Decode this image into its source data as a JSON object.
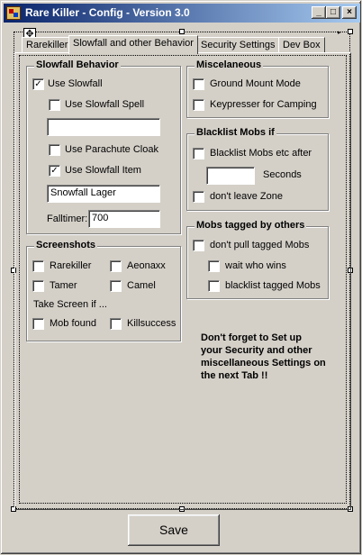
{
  "window": {
    "title": "Rare Killer - Config - Version 3.0",
    "controls": {
      "minimize": "_",
      "maximize": "□",
      "close": "×"
    }
  },
  "tabs": [
    {
      "label": "Rarekiller",
      "active": false
    },
    {
      "label": "Slowfall and other Behavior",
      "active": true
    },
    {
      "label": "Security Settings",
      "active": false
    },
    {
      "label": "Dev Box",
      "active": false
    }
  ],
  "slowfall": {
    "title": "Slowfall Behavior",
    "use_slowfall": {
      "label": "Use Slowfall",
      "checked": true
    },
    "use_slowfall_spell": {
      "label": "Use Slowfall Spell",
      "checked": false
    },
    "spell_value": "",
    "use_parachute": {
      "label": "Use Parachute Cloak",
      "checked": false
    },
    "use_item": {
      "label": "Use Slowfall Item",
      "checked": true
    },
    "item_value": "Snowfall Lager",
    "falltimer_label": "Falltimer:",
    "falltimer_value": "700"
  },
  "misc": {
    "title": "Miscelaneous",
    "ground_mount": {
      "label": "Ground Mount Mode",
      "checked": false
    },
    "keypresser": {
      "label": "Keypresser for Camping",
      "checked": false
    }
  },
  "blacklist": {
    "title": "Blacklist Mobs if",
    "after": {
      "label": "Blacklist Mobs etc after",
      "checked": false
    },
    "seconds_value": "",
    "seconds_label": "Seconds",
    "dont_leave": {
      "label": "don't leave Zone",
      "checked": false
    }
  },
  "tagged": {
    "title": "Mobs tagged by others",
    "dont_pull": {
      "label": "don't pull tagged Mobs",
      "checked": false
    },
    "wait": {
      "label": "wait who wins",
      "checked": false
    },
    "blacklist_tagged": {
      "label": "blacklist tagged Mobs",
      "checked": false
    }
  },
  "screenshots": {
    "title": "Screenshots",
    "rarekiller": {
      "label": "Rarekiller",
      "checked": false
    },
    "aeonaxx": {
      "label": "Aeonaxx",
      "checked": false
    },
    "tamer": {
      "label": "Tamer",
      "checked": false
    },
    "camel": {
      "label": "Camel",
      "checked": false
    },
    "take_screen_label": "Take Screen if ...",
    "mob_found": {
      "label": "Mob found",
      "checked": false
    },
    "killsuccess": {
      "label": "Killsuccess",
      "checked": false
    }
  },
  "note": {
    "line1": "Don't forget to Set up",
    "line2": "your Security and other",
    "line3": "miscellaneous Settings on",
    "line4": "the next Tab !!"
  },
  "save_label": "Save",
  "colors": {
    "face": "#d4d0c8",
    "title_start": "#0a246a",
    "title_end": "#a6caf0"
  }
}
